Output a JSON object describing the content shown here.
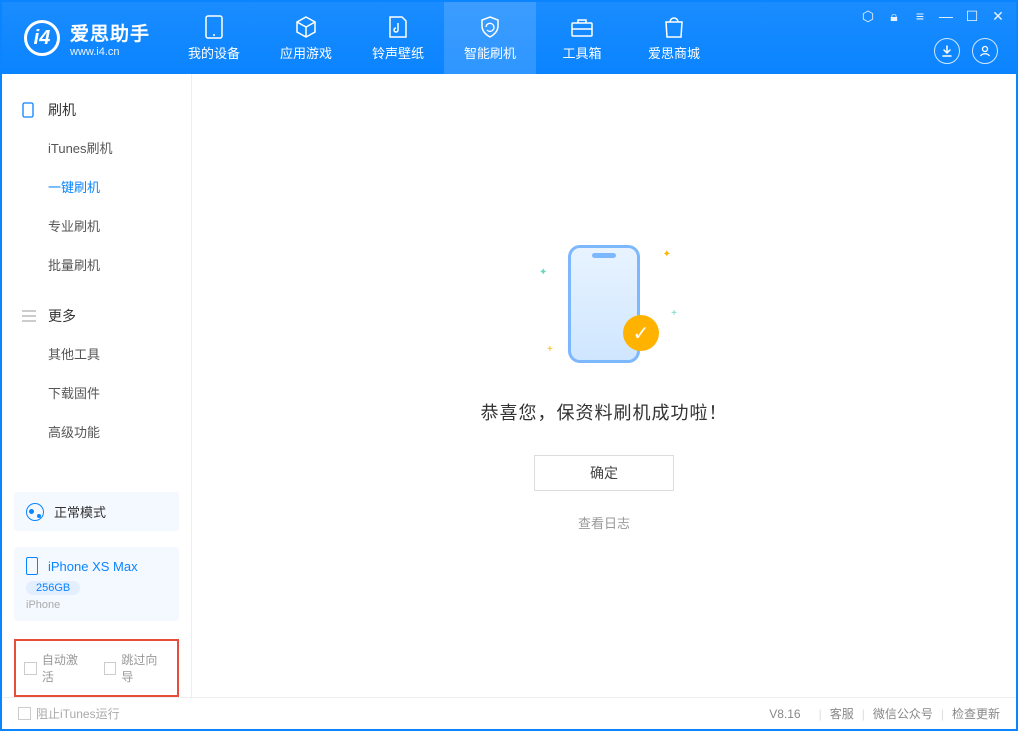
{
  "app": {
    "name": "爱思助手",
    "url": "www.i4.cn"
  },
  "header_tabs": [
    {
      "label": "我的设备"
    },
    {
      "label": "应用游戏"
    },
    {
      "label": "铃声壁纸"
    },
    {
      "label": "智能刷机"
    },
    {
      "label": "工具箱"
    },
    {
      "label": "爱思商城"
    }
  ],
  "sidebar": {
    "section1_title": "刷机",
    "items1": [
      {
        "label": "iTunes刷机"
      },
      {
        "label": "一键刷机"
      },
      {
        "label": "专业刷机"
      },
      {
        "label": "批量刷机"
      }
    ],
    "section2_title": "更多",
    "items2": [
      {
        "label": "其他工具"
      },
      {
        "label": "下载固件"
      },
      {
        "label": "高级功能"
      }
    ],
    "mode_label": "正常模式",
    "device_name": "iPhone XS Max",
    "device_storage": "256GB",
    "device_model": "iPhone",
    "opt_auto_activate": "自动激活",
    "opt_skip_guide": "跳过向导"
  },
  "main": {
    "success_text": "恭喜您，保资料刷机成功啦！",
    "ok_button": "确定",
    "view_log": "查看日志"
  },
  "footer": {
    "block_itunes": "阻止iTunes运行",
    "version": "V8.16",
    "link_service": "客服",
    "link_wechat": "微信公众号",
    "link_update": "检查更新"
  }
}
